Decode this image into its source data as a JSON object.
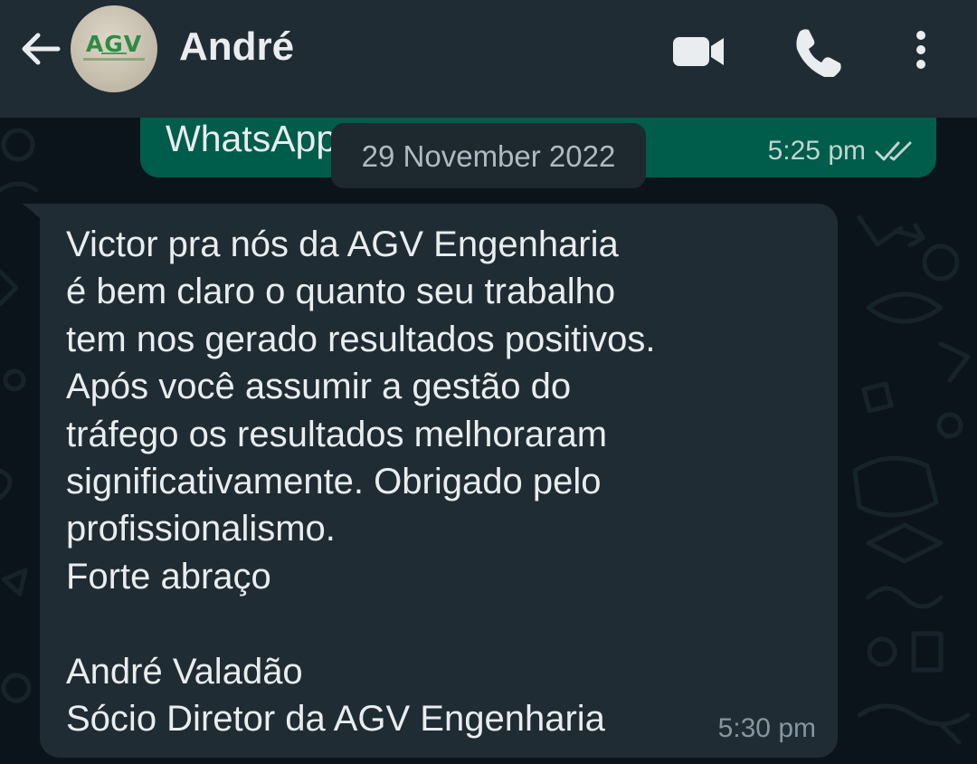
{
  "header": {
    "contact_name": "André",
    "avatar_logo_text": "AGV",
    "back_icon": "arrow-left-icon",
    "video_icon": "video-camera-icon",
    "call_icon": "phone-icon",
    "menu_icon": "more-vertical-icon"
  },
  "previous_message": {
    "text": "WhatsApp",
    "time": "5:25 pm",
    "status_icon": "double-check-icon"
  },
  "date_separator": "29 November 2022",
  "message": {
    "lines": [
      "Victor pra nós da AGV Engenharia",
      "é bem claro o quanto seu trabalho",
      "tem nos gerado resultados positivos.",
      "Após você assumir a gestão do",
      "tráfego os resultados melhoraram",
      "significativamente. Obrigado pelo",
      "profissionalismo.",
      "Forte abraço",
      "",
      "André Valadão",
      "Sócio Diretor da AGV Engenharia"
    ],
    "time": "5:30 pm"
  },
  "colors": {
    "header_bg": "#1f2c34",
    "chat_bg": "#0b141a",
    "incoming_bubble": "#202c33",
    "outgoing_bubble": "#005c4b",
    "text_primary": "#e9edef",
    "text_secondary": "#8696a0",
    "read_ticks": "#bfd6cf"
  }
}
